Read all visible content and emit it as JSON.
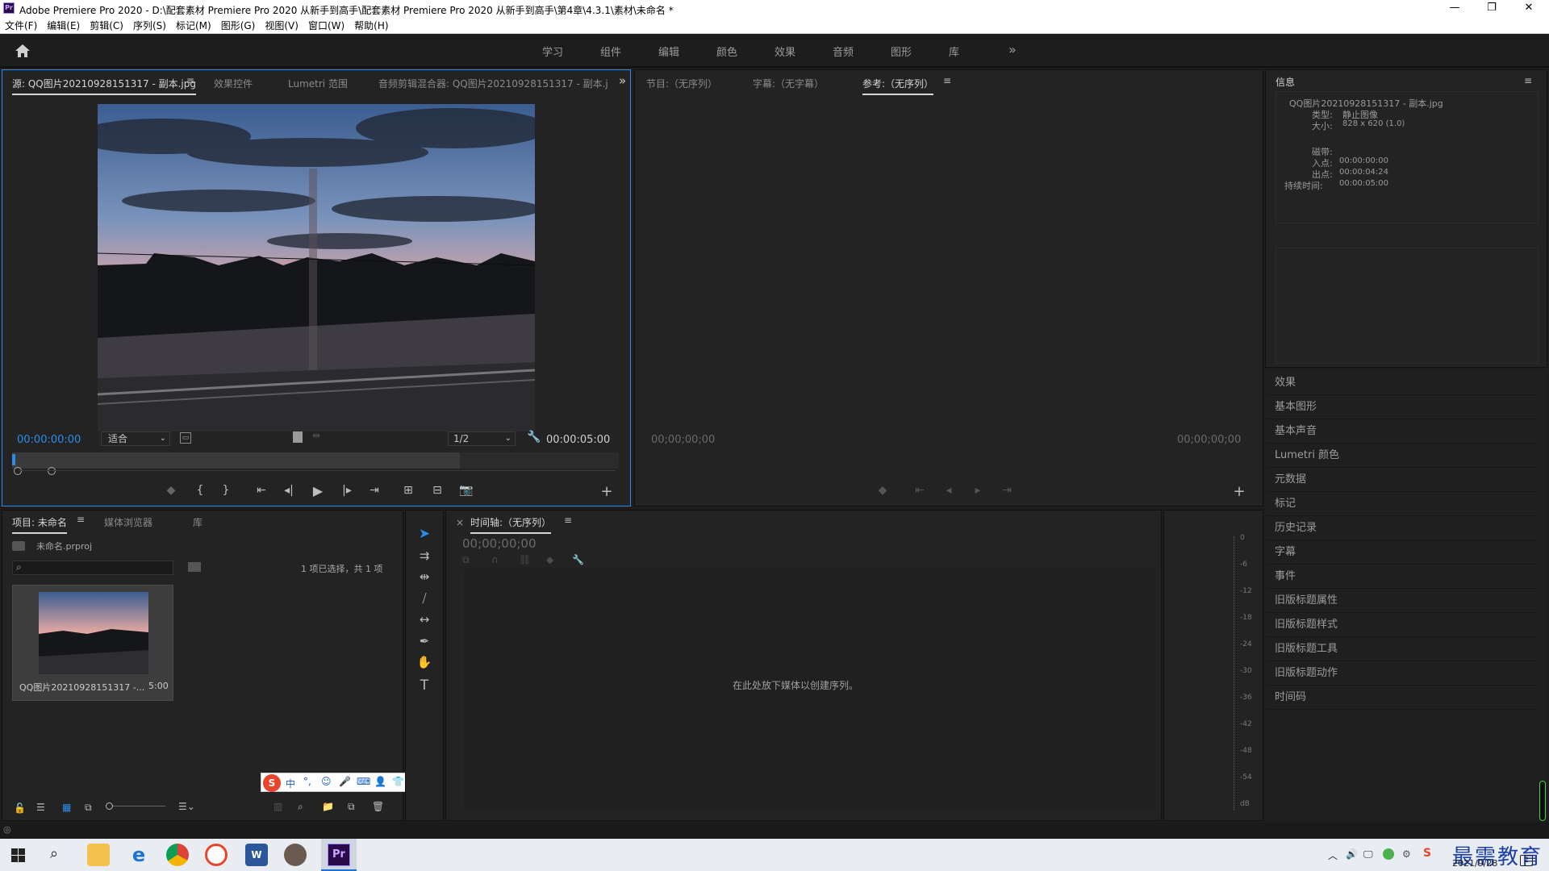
{
  "window": {
    "title": "Adobe Premiere Pro 2020 - D:\\配套素材 Premiere Pro 2020 从新手到高手\\配套素材 Premiere Pro 2020 从新手到高手\\第4章\\4.3.1\\素材\\未命名 *",
    "minimize": "—",
    "maximize": "❐",
    "close": "✕"
  },
  "menu": [
    "文件(F)",
    "编辑(E)",
    "剪辑(C)",
    "序列(S)",
    "标记(M)",
    "图形(G)",
    "视图(V)",
    "窗口(W)",
    "帮助(H)"
  ],
  "workspaces": [
    "学习",
    "组件",
    "编辑",
    "颜色",
    "效果",
    "音频",
    "图形",
    "库"
  ],
  "workspace_more": "»",
  "source_panel": {
    "tabs": [
      "源: QQ图片20210928151317 - 副本.jpg",
      "效果控件",
      "Lumetri 范围",
      "音频剪辑混合器: QQ图片20210928151317 - 副本.j"
    ],
    "more": "»",
    "timecode_in": "00:00:00:00",
    "fit_label": "适合",
    "resolution": "1/2",
    "timecode_out": "00:00:05:00"
  },
  "program_panel": {
    "tabs": [
      "节目:（无序列）",
      "字幕:（无字幕）",
      "参考:（无序列）"
    ],
    "timecode_left": "00;00;00;00",
    "timecode_right": "00;00;00;00"
  },
  "info_panel": {
    "title": "信息",
    "filename": "QQ图片20210928151317 - 副本.jpg",
    "type_label": "类型:",
    "type_value": "静止图像",
    "size_label": "大小:",
    "size_value": "828 x 620 (1.0)",
    "tape_label": "磁带:",
    "in_label": "入点:",
    "in_value": "00:00:00:00",
    "out_label": "出点:",
    "out_value": "00:00:04:24",
    "duration_label": "持续时间:",
    "duration_value": "00:00:05:00"
  },
  "side_items": [
    "效果",
    "基本图形",
    "基本声音",
    "Lumetri 颜色",
    "元数据",
    "标记",
    "历史记录",
    "字幕",
    "事件",
    "旧版标题属性",
    "旧版标题样式",
    "旧版标题工具",
    "旧版标题动作",
    "时间码"
  ],
  "project_panel": {
    "tabs": [
      "项目: 未命名",
      "媒体浏览器",
      "库"
    ],
    "project_file": "未命名.prproj",
    "selection_info": "1 项已选择，共 1 项",
    "item_name": "QQ图片20210928151317 -...",
    "item_duration": "5:00"
  },
  "timeline_panel": {
    "close": "×",
    "title": "时间轴:（无序列）",
    "timecode": "00;00;00;00",
    "empty_hint": "在此处放下媒体以创建序列。"
  },
  "audio_meter": {
    "ticks": [
      "0",
      "-6",
      "-12",
      "-18",
      "-24",
      "-30",
      "-36",
      "-42",
      "-48",
      "-54",
      "dB"
    ]
  },
  "ime_bar": [
    "中",
    "°,",
    "☺",
    "🎤",
    "⌨",
    "👤",
    "👕",
    "▦"
  ],
  "taskbar": {
    "date": "2021/9/28",
    "watermark": "最需教育"
  },
  "colors": {
    "accent_blue": "#2d8ceb",
    "panel_bg": "#232323",
    "app_bg": "#1d1d1d"
  }
}
